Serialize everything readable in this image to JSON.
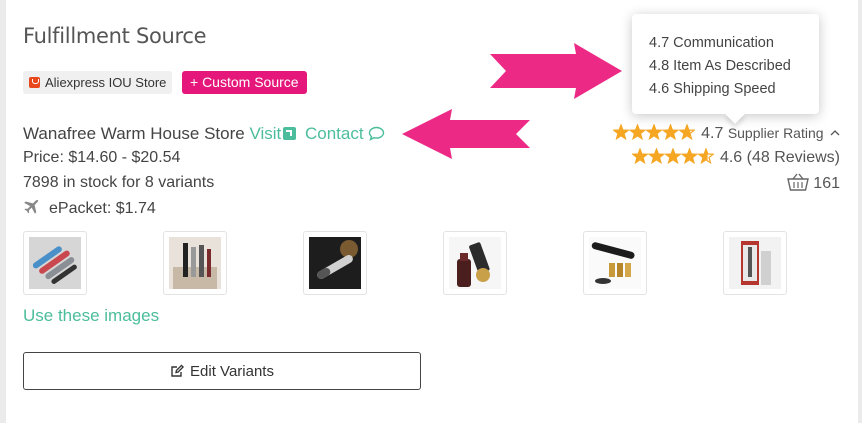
{
  "section_title": "Fulfillment Source",
  "tags": {
    "aliexpress": "Aliexpress IOU Store",
    "custom": "+ Custom Source"
  },
  "store": {
    "name": "Wanafree Warm House Store",
    "visit": "Visit",
    "contact": "Contact"
  },
  "price": "Price: $14.60 - $20.54",
  "stock": "7898 in stock for 8 variants",
  "shipping": "ePacket: $1.74",
  "use_images": "Use these images",
  "edit_variants": "Edit Variants",
  "rating": {
    "supplier_value": "4.7",
    "supplier_label": "Supplier Rating",
    "supplier_stars": 4.7,
    "product_value": "4.6",
    "product_stars": 4.6,
    "reviews_label": "(48 Reviews)",
    "orders": "161"
  },
  "tooltip": {
    "communication": "4.7 Communication",
    "item_as_described": "4.8 Item As Described",
    "shipping_speed": "4.6 Shipping Speed"
  },
  "colors": {
    "accent_green": "#4cbd9c",
    "brand_pink": "#e5177b",
    "arrow_pink": "#ec2a86",
    "star_orange": "#f5a623"
  },
  "icons": [
    "aliexpress-icon",
    "external-link-icon",
    "chat-bubble-icon",
    "airplane-icon",
    "edit-icon",
    "basket-icon",
    "chevron-up-icon",
    "star-icon"
  ]
}
